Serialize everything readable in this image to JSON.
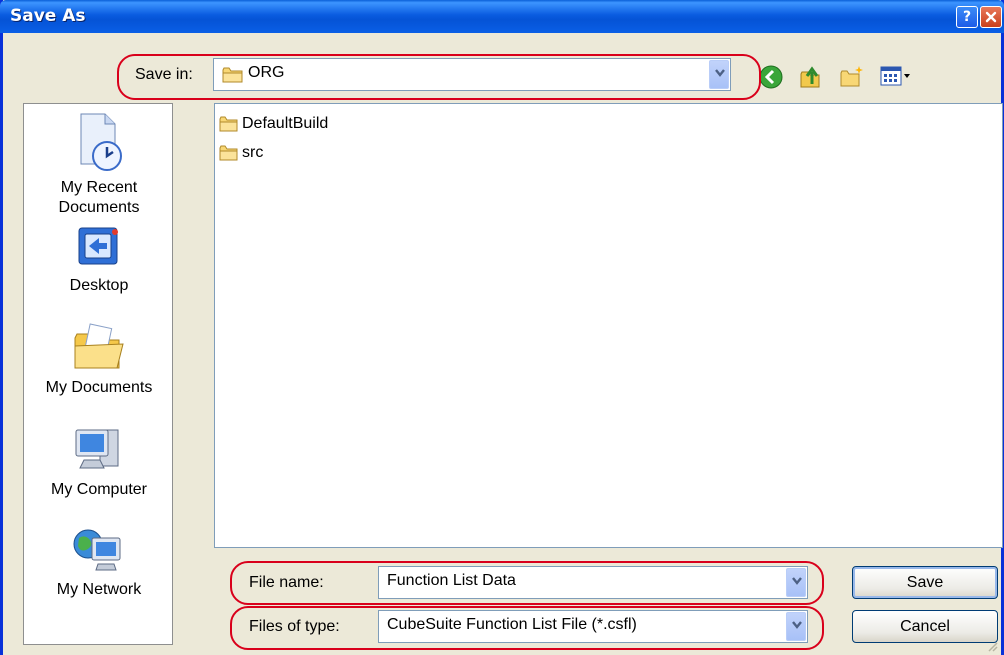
{
  "window": {
    "title": "Save As"
  },
  "title_buttons": {
    "help": "?",
    "close": "X"
  },
  "save_in": {
    "label": "Save in:",
    "value": "ORG"
  },
  "toolbar": {
    "back_icon": "back-arrow-icon",
    "up_icon": "up-one-level-icon",
    "new_folder_icon": "new-folder-icon",
    "views_icon": "views-menu-icon"
  },
  "places": [
    {
      "label_line1": "My Recent",
      "label_line2": "Documents",
      "icon": "recent-documents-icon"
    },
    {
      "label_line1": "Desktop",
      "label_line2": "",
      "icon": "desktop-icon"
    },
    {
      "label_line1": "My Documents",
      "label_line2": "",
      "icon": "my-documents-icon"
    },
    {
      "label_line1": "My Computer",
      "label_line2": "",
      "icon": "my-computer-icon"
    },
    {
      "label_line1": "My Network",
      "label_line2": "",
      "icon": "my-network-icon"
    }
  ],
  "files": [
    {
      "name": "DefaultBuild",
      "icon": "folder-icon"
    },
    {
      "name": "src",
      "icon": "folder-icon"
    }
  ],
  "file_name": {
    "label": "File name:",
    "value": "Function List Data"
  },
  "file_type": {
    "label": "Files of type:",
    "value": "CubeSuite Function List File (*.csfl)"
  },
  "buttons": {
    "save": "Save",
    "cancel": "Cancel"
  },
  "colors": {
    "annotation": "#d9001b",
    "titlebar": "#0a5fd8",
    "dialog_bg": "#ece9d8"
  }
}
